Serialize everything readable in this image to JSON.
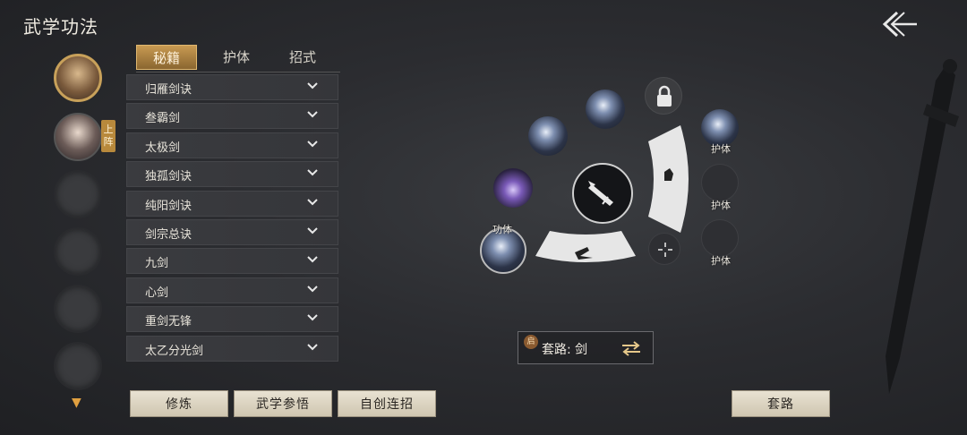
{
  "header": {
    "title": "武学功法"
  },
  "sidebar": {
    "on_formation_label": "上阵"
  },
  "tabs": [
    {
      "label": "秘籍",
      "active": true
    },
    {
      "label": "护体",
      "active": false
    },
    {
      "label": "招式",
      "active": false
    }
  ],
  "skills": [
    "归雁剑诀",
    "叁霸剑",
    "太极剑",
    "独孤剑诀",
    "纯阳剑诀",
    "剑宗总诀",
    "九剑",
    "心剑",
    "重剑无锋",
    "太乙分光剑"
  ],
  "buttons": {
    "cultivate": "修炼",
    "comprehend": "武学参悟",
    "custom_combo": "自创连招",
    "routine": "套路"
  },
  "wheel": {
    "gongti_label": "功体",
    "huti_labels": [
      "护体",
      "护体",
      "护体"
    ]
  },
  "route": {
    "badge": "启",
    "text": "套路: 剑"
  },
  "colors": {
    "accent_gold": "#c8a15a",
    "background": "#2b2c30"
  }
}
